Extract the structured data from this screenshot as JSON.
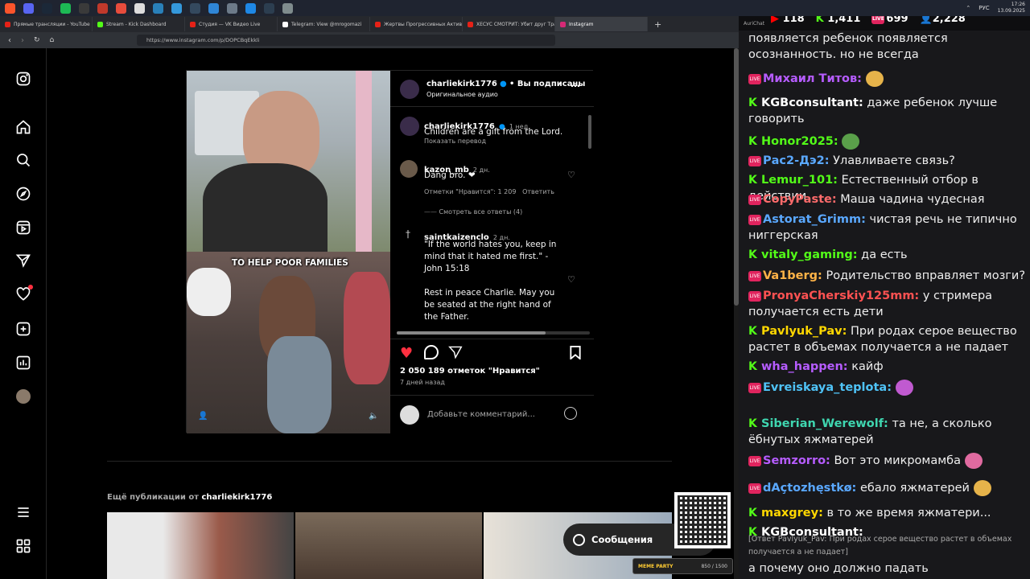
{
  "taskbar": {
    "lang": "РУС",
    "time": "17:26",
    "date": "13.09.2025"
  },
  "browser": {
    "tabs": [
      {
        "label": "Прямые трансляции - YouTube S",
        "color": "#e62117"
      },
      {
        "label": "Stream - Kick Dashboard",
        "color": "#53fc18"
      },
      {
        "label": "Студия — VK Видео Live",
        "color": "#e62117"
      },
      {
        "label": "Telegram: View @mrogomazi",
        "color": "#ffffff"
      },
      {
        "label": "Жертвы Прогрессивных Активи",
        "color": "#e62117"
      },
      {
        "label": "ХЕСУС СМОТРИТ: Убит друг Трам",
        "color": "#e62117"
      },
      {
        "label": "Instagram",
        "color": "#d62976"
      }
    ],
    "url": "https://www.instagram.com/p/DOPCBqEkkli"
  },
  "post": {
    "author": "charliekirk1776",
    "following": "• Вы подписаны",
    "audio": "Оригинальное аудио",
    "caption_user": "charliekirk1776",
    "caption_time": "1 нед.",
    "caption_text": "Children are a gift from the Lord.",
    "translate": "Показать перевод",
    "video_caption": "TO HELP POOR FAMILIES",
    "comments": [
      {
        "user": "kazon_mb",
        "time": "2 дн.",
        "text": "Dang bro. ❤",
        "likes": "Отметки \"Нравится\": 1 209",
        "reply": "Ответить"
      },
      {
        "user": "saintkaizenclo",
        "time": "2 дн.",
        "text1": "\"If the world hates you, keep in mind that it hated me first.\" - John 15:18",
        "text2": "Rest in peace Charlie. May you be seated at the right hand of the Father."
      }
    ],
    "view_replies": "Смотреть все ответы (4)",
    "likes": "2 050 189 отметок \"Нравится\"",
    "posted": "7 дней назад",
    "add_comment": "Добавьте комментарий...",
    "more_from_label": "Ещё публикации от",
    "more_from_user": "charliekirk1776",
    "messages_button": "Сообщения"
  },
  "chat": {
    "app": "AuriChat",
    "stats": {
      "youtube": "118",
      "kick": "1,411",
      "live": "699",
      "viewers": "2,228"
    },
    "messages": [
      {
        "platform": "",
        "user": "",
        "color": "#eee",
        "text": "появляется ребенок появляется осознанность. но не всегда"
      },
      {
        "platform": "live",
        "user": "Михаил Титов:",
        "color": "#b65cff",
        "text": "",
        "emote": "#e6b34a"
      },
      {
        "platform": "kick",
        "user": "KGBconsultant:",
        "color": "#ffffff",
        "text": "даже ребенок лучше говорить"
      },
      {
        "platform": "kick",
        "user": "Honor2025:",
        "color": "#53fc18",
        "text": "",
        "emote": "#5aa04a"
      },
      {
        "platform": "live",
        "user": "Рас2-Дэ2:",
        "color": "#5aa8ff",
        "text": "Улавливаете связь?"
      },
      {
        "platform": "kick",
        "user": "Lemur_101:",
        "color": "#53fc18",
        "text": "Естественный отбор в действии"
      },
      {
        "platform": "live",
        "user": "CopyPaste:",
        "color": "#ff6b6b",
        "text": "Маша чадина чудесная"
      },
      {
        "platform": "live",
        "user": "Astorat_Grimm:",
        "color": "#5aa8ff",
        "text": "чистая речь не типично ниггерская"
      },
      {
        "platform": "kick",
        "user": "vitaly_gaming:",
        "color": "#53fc18",
        "text": "да есть"
      },
      {
        "platform": "live",
        "user": "Va1berg:",
        "color": "#ffb347",
        "text": "Родительство вправляет мозги?"
      },
      {
        "platform": "live",
        "user": "PronyaCherskiy125mm:",
        "color": "#ff5252",
        "text": "у стримера получается есть дети"
      },
      {
        "platform": "kick",
        "user": "Pavlyuk_Pav:",
        "color": "#ffd700",
        "text": "При родах серое вещество растет в объемах получается а не падает"
      },
      {
        "platform": "kick",
        "user": "wha_happen:",
        "color": "#b65cff",
        "text": "кайф"
      },
      {
        "platform": "live",
        "user": "Evreiskaya_teplota:",
        "color": "#4fc3f7",
        "text": "",
        "emote": "#c05ad0"
      },
      {
        "platform": "kick",
        "user": "Siberian_Werewolf:",
        "color": "#3fd6b0",
        "text": "та не, а сколько ёбнутых яжматерей"
      },
      {
        "platform": "live",
        "user": "Semzorro:",
        "color": "#b65cff",
        "text": "Вот это микромамба",
        "emote": "#e06aa0"
      },
      {
        "platform": "live",
        "user": "dAçtozhęstkø:",
        "color": "#5aa8ff",
        "text": "ебало яжматерей",
        "emote": "#e6b34a"
      },
      {
        "platform": "kick",
        "user": "maxgrey:",
        "color": "#ffd700",
        "text": "в то же время яжматери..."
      },
      {
        "platform": "kick",
        "user": "KGBconsultant:",
        "color": "#ffffff",
        "text": ""
      }
    ],
    "reply_note": "[Ответ Pavlyuk_Pav: При родах серое вещество растет в объемах получается а не падает]",
    "last_text": "а почему оно должно падать",
    "meme_party": "MEME PARTY",
    "meme_progress": "850 / 1500"
  }
}
